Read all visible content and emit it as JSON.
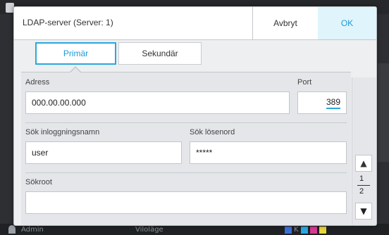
{
  "dialog": {
    "title": "LDAP-server (Server: 1)",
    "cancel_label": "Avbryt",
    "ok_label": "OK"
  },
  "tabs": [
    {
      "label": "Primär",
      "selected": true
    },
    {
      "label": "Sekundär",
      "selected": false
    }
  ],
  "form": {
    "address_label": "Adress",
    "address_value": "000.00.00.000",
    "port_label": "Port",
    "port_value": "389",
    "login_label": "Sök inloggningsnamn",
    "login_value": "user",
    "password_label": "Sök lösenord",
    "password_value": "*****",
    "searchroot_label": "Sökroot",
    "searchroot_value": ""
  },
  "pager": {
    "current": "1",
    "total": "2",
    "up_icon": "triangle-up-icon",
    "down_icon": "triangle-down-icon"
  },
  "background": {
    "user_label": "Admin",
    "mode_label": "Viloläge",
    "ink_label": "K"
  },
  "colors": {
    "accent": "#2aa7dd",
    "ok_bg": "#dff4fb",
    "ok_text": "#1a9ad6"
  }
}
